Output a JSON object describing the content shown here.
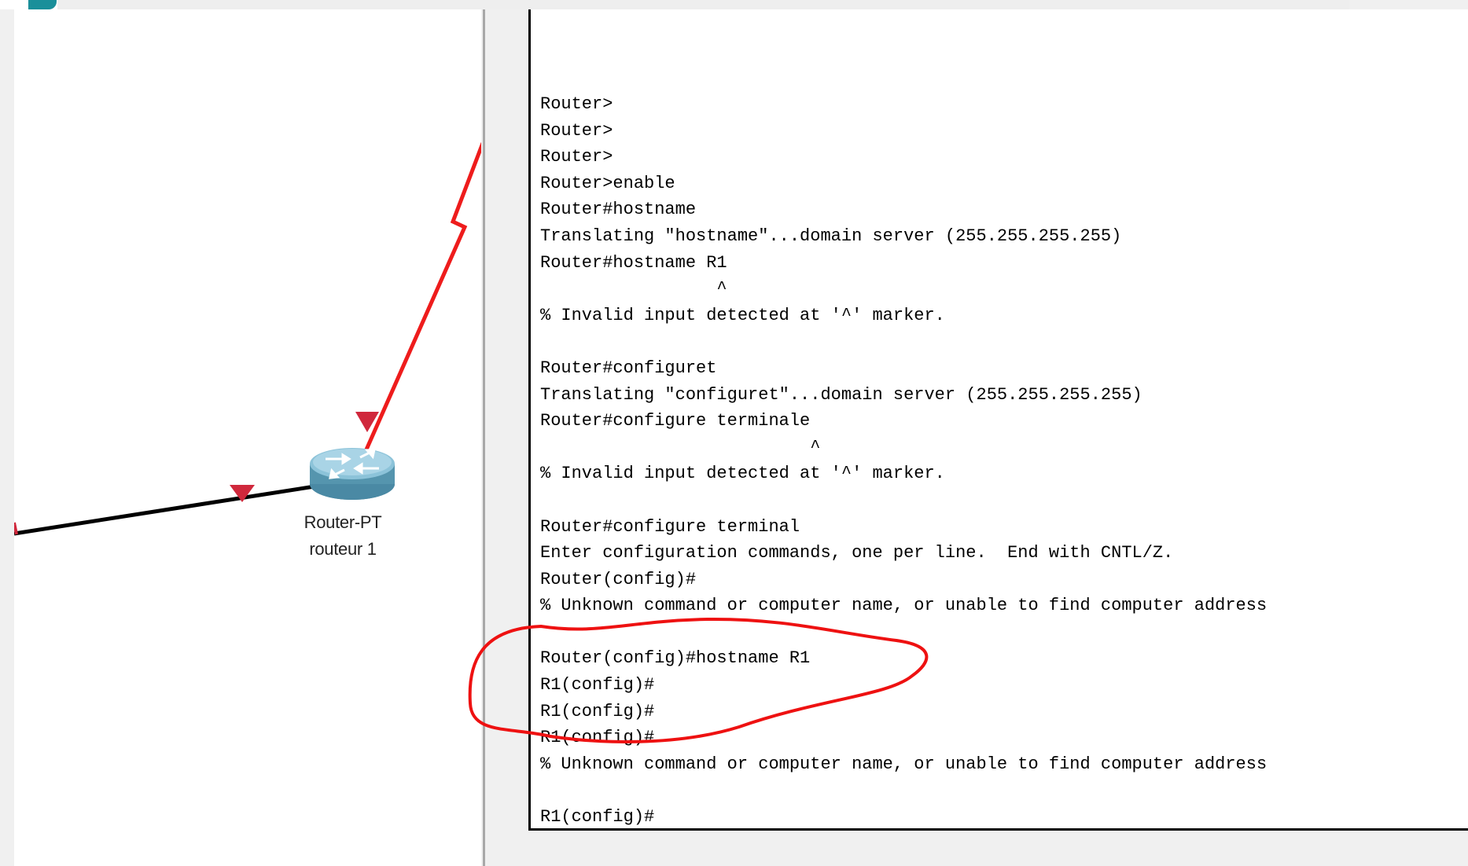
{
  "colors": {
    "link_serial": "#ee1c1c",
    "link_copper": "#000000",
    "link_endpoint": "#d0283c",
    "annotation": "#ee1111",
    "router_body": "#5d9eb8"
  },
  "topology": {
    "device": {
      "icon": "router-icon",
      "model": "Router-PT",
      "name": "routeur 1"
    }
  },
  "terminal": {
    "lines": [
      "Router>",
      "Router>",
      "Router>",
      "Router>enable",
      "Router#hostname",
      "Translating \"hostname\"...domain server (255.255.255.255)",
      "Router#hostname R1",
      "                 ^",
      "% Invalid input detected at '^' marker.",
      "",
      "Router#configuret",
      "Translating \"configuret\"...domain server (255.255.255.255)",
      "Router#configure terminale",
      "                          ^",
      "% Invalid input detected at '^' marker.",
      "",
      "Router#configure terminal",
      "Enter configuration commands, one per line.  End with CNTL/Z.",
      "Router(config)#",
      "% Unknown command or computer name, or unable to find computer address",
      "",
      "Router(config)#hostname R1",
      "R1(config)#",
      "R1(config)#",
      "R1(config)#",
      "% Unknown command or computer name, or unable to find computer address",
      "",
      "R1(config)#"
    ]
  }
}
